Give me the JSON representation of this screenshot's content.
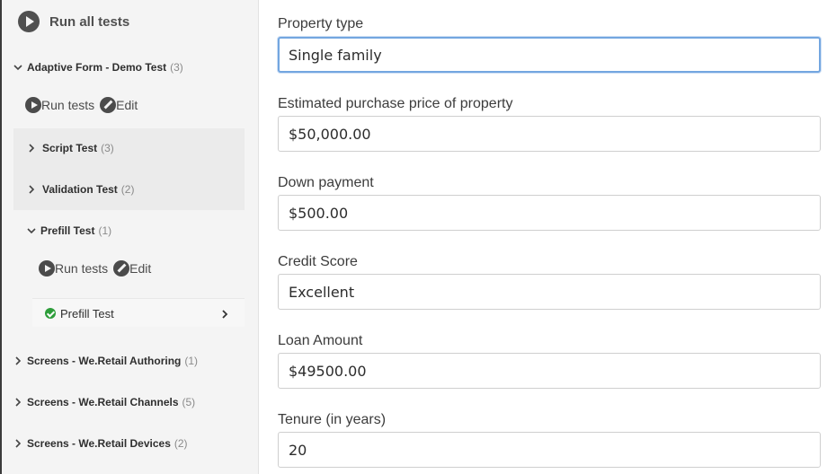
{
  "sidebar": {
    "run_all_label": "Run all tests",
    "suite": {
      "label": "Adaptive Form - Demo Test",
      "count": "(3)",
      "run_label": "Run tests",
      "edit_label": "Edit",
      "children": [
        {
          "label": "Script Test",
          "count": "(3)"
        },
        {
          "label": "Validation Test",
          "count": "(2)"
        },
        {
          "label": "Prefill Test",
          "count": "(1)"
        }
      ],
      "prefill": {
        "run_label": "Run tests",
        "edit_label": "Edit",
        "item_label": "Prefill Test"
      }
    },
    "other_suites": [
      {
        "label": "Screens - We.Retail Authoring",
        "count": "(1)"
      },
      {
        "label": "Screens - We.Retail Channels",
        "count": "(5)"
      },
      {
        "label": "Screens - We.Retail Devices",
        "count": "(2)"
      }
    ]
  },
  "form": {
    "fields": [
      {
        "label": "Property type",
        "value": "Single family"
      },
      {
        "label": "Estimated purchase price of property",
        "value": "$50,000.00"
      },
      {
        "label": "Down payment",
        "value": "$500.00"
      },
      {
        "label": "Credit Score",
        "value": "Excellent"
      },
      {
        "label": "Loan Amount",
        "value": "$49500.00"
      },
      {
        "label": "Tenure (in years)",
        "value": "20"
      }
    ]
  },
  "colors": {
    "sidebar_bg": "#f4f4f4",
    "focus_border": "#73a6e0",
    "success_green": "#2d9d3a"
  },
  "icons": [
    "play-circle-icon",
    "pencil-icon",
    "chevron-down-icon",
    "chevron-right-icon",
    "check-circle-icon"
  ]
}
